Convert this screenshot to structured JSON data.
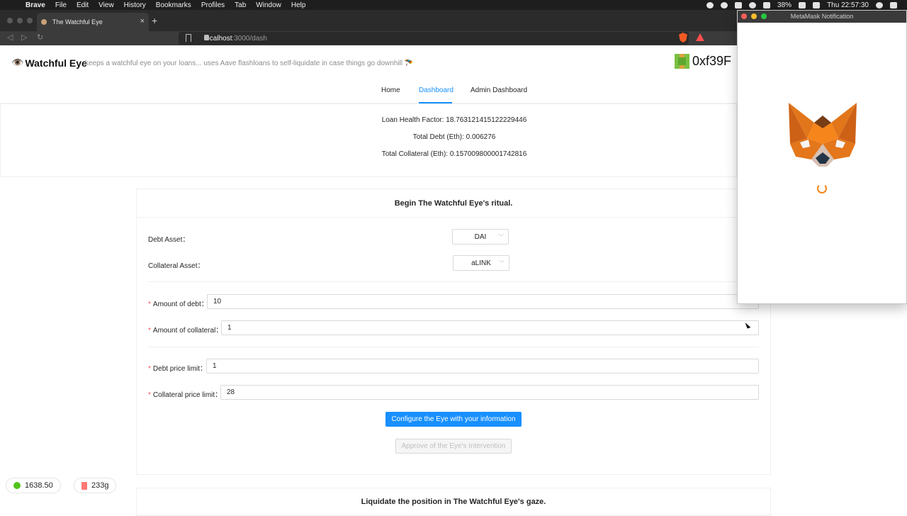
{
  "menubar": {
    "items": [
      "Brave",
      "File",
      "Edit",
      "View",
      "History",
      "Bookmarks",
      "Profiles",
      "Tab",
      "Window",
      "Help"
    ],
    "battery": "38%",
    "clock": "Thu 22:57:30"
  },
  "browser": {
    "tab_title": "The Watchful Eye",
    "url_host": "localhost",
    "url_path": ":3000/dash"
  },
  "header": {
    "brand": "Watchful Eye",
    "tagline": "keeps a watchful eye on your loans... uses Aave flashloans to self-liquidate in case things go downhill 🪂",
    "address": "0xf39F"
  },
  "nav": {
    "items": [
      "Home",
      "Dashboard",
      "Admin Dashboard"
    ],
    "active": "Dashboard"
  },
  "stats": {
    "health": "Loan Health Factor: 18.763121415122229446",
    "debt": "Total Debt (Eth): 0.006276",
    "collateral": "Total Collateral (Eth): 0.157009800001742816"
  },
  "ritual_form": {
    "title": "Begin The Watchful Eye's ritual.",
    "debt_asset_label": "Debt Asset",
    "debt_asset_value": "DAI",
    "collateral_asset_label": "Collateral Asset",
    "collateral_asset_value": "aLINK",
    "amount_debt_label": "Amount of debt",
    "amount_debt_value": "10",
    "amount_collateral_label": "Amount of collateral",
    "amount_collateral_value": "1",
    "debt_price_label": "Debt price limit",
    "debt_price_value": "1",
    "collateral_price_label": "Collateral price limit",
    "collateral_price_value": "28",
    "configure_button": "Configure the Eye with your information",
    "approve_button": "Approve of the Eye's Intervention"
  },
  "liquidate_card": {
    "title": "Liquidate the position in The Watchful Eye's gaze."
  },
  "footer_pills": {
    "balance": "1638.50",
    "gas": "233g"
  },
  "metamask": {
    "title": "MetaMask Notification"
  },
  "colors": {
    "primary": "#1890ff",
    "required": "#ff4d4f",
    "fox": "#f6851b"
  }
}
